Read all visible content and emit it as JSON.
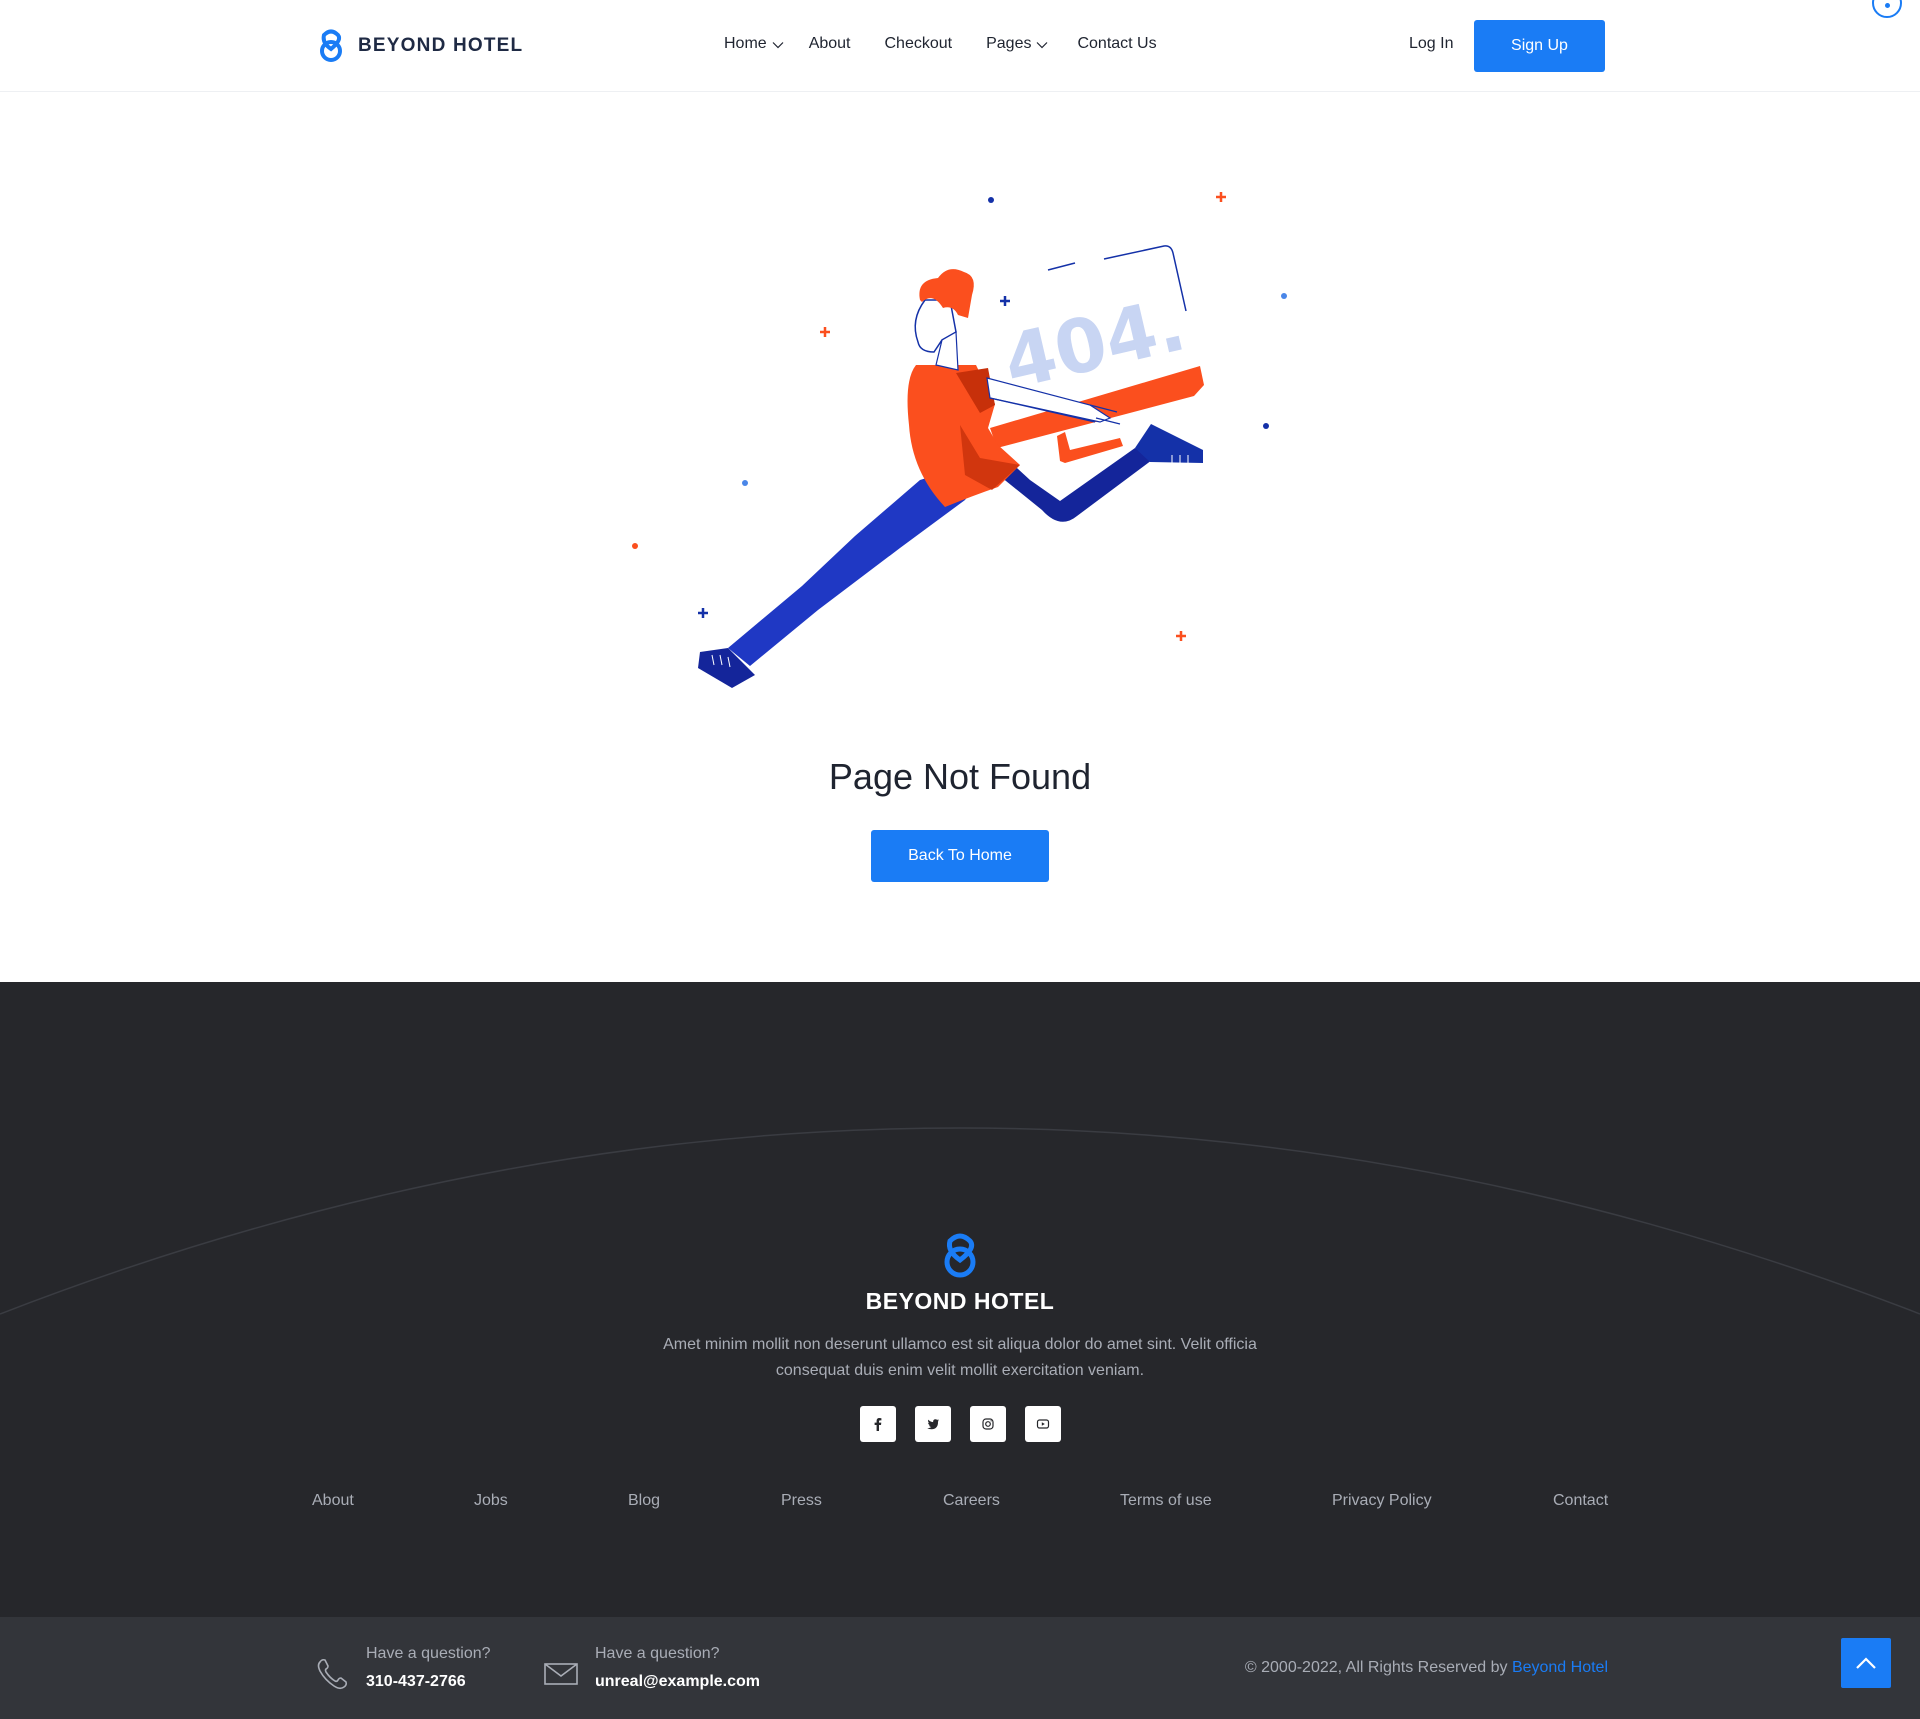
{
  "header": {
    "brand_name": "BEYOND HOTEL",
    "nav": [
      {
        "label": "Home",
        "has_dropdown": true
      },
      {
        "label": "About",
        "has_dropdown": false
      },
      {
        "label": "Checkout",
        "has_dropdown": false
      },
      {
        "label": "Pages",
        "has_dropdown": true
      },
      {
        "label": "Contact Us",
        "has_dropdown": false
      }
    ],
    "login_label": "Log In",
    "signup_label": "Sign Up"
  },
  "hero": {
    "illustration_text": "404.",
    "title": "Page Not Found",
    "button_label": "Back To Home"
  },
  "footer": {
    "brand_name": "BEYOND HOTEL",
    "description": "Amet minim mollit non deserunt ullamco est sit aliqua dolor do amet sint. Velit officia consequat duis enim velit mollit exercitation veniam.",
    "socials": [
      "facebook-icon",
      "twitter-icon",
      "instagram-icon",
      "youtube-icon"
    ],
    "links": [
      "About",
      "Jobs",
      "Blog",
      "Press",
      "Careers",
      "Terms of use",
      "Privacy Policy",
      "Contact"
    ],
    "phone": {
      "label": "Have a question?",
      "value": "310-437-2766"
    },
    "email": {
      "label": "Have a question?",
      "value": "unreal@example.com"
    },
    "copyright_prefix": "© 2000-2022, All Rights Reserved by ",
    "copyright_link": "Beyond Hotel"
  },
  "colors": {
    "accent": "#1a7cf5",
    "footer_bg": "#26272b",
    "bottom_bar_bg": "#33353a",
    "illustration_orange": "#fb4f1e",
    "illustration_navy": "#1431a8"
  }
}
